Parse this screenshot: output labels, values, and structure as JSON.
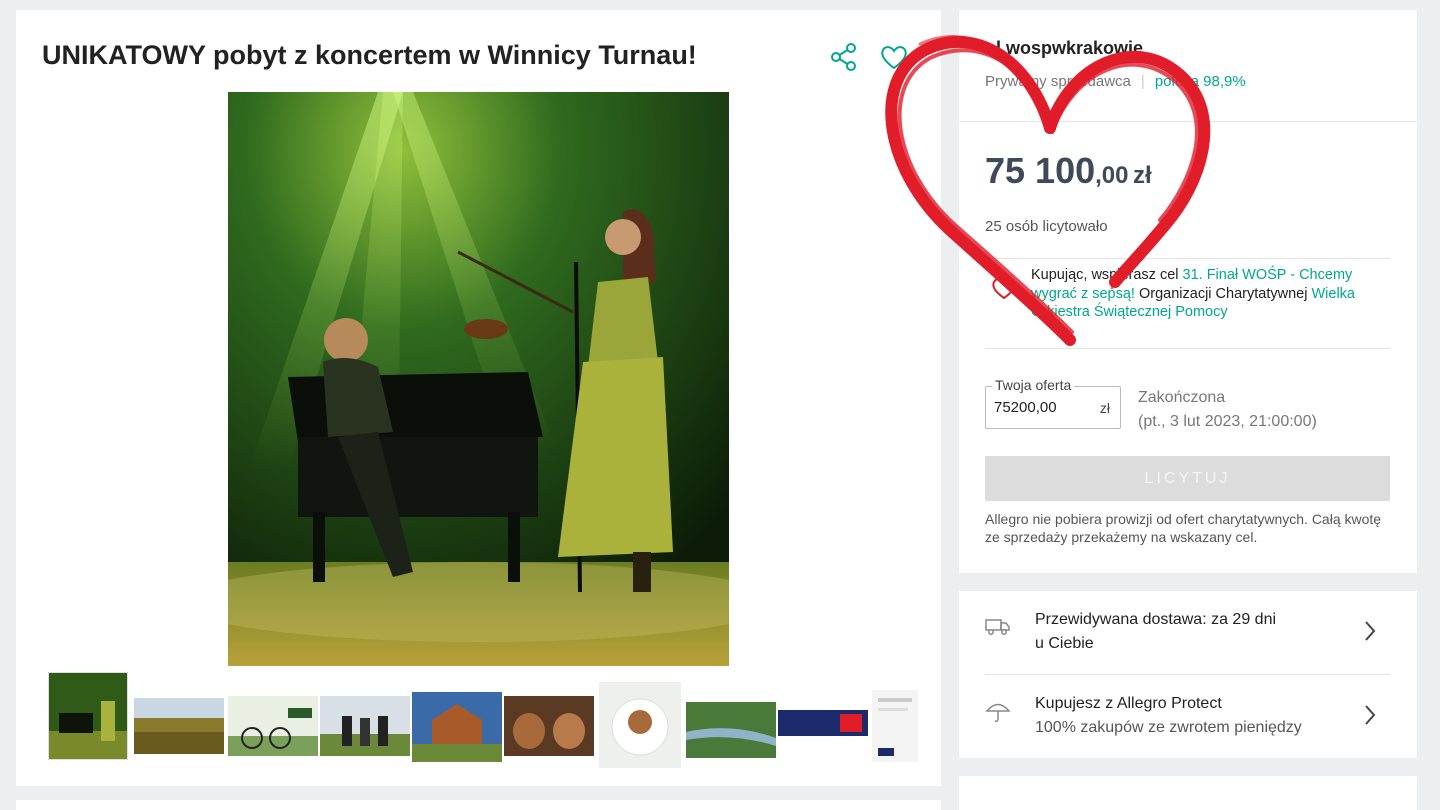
{
  "listing": {
    "title": "UNIKATOWY pobyt z koncertem w Winnicy Turnau!"
  },
  "icons": {
    "share": "share-icon",
    "favorite": "heart-outline-icon"
  },
  "seller": {
    "name": "ol wospwkrakowie",
    "type": "Prywatny sprzedawca",
    "rating": "poleca 98,9%"
  },
  "price": {
    "whole": "75 100",
    "fraction": ",00",
    "currency": "zł"
  },
  "bidders": "25 osób licytowało",
  "charity": {
    "prefix": "Kupując, wspierasz cel ",
    "goal": "31. Finał WOŚP - Chcemy wygrać z sepsą!",
    "org_prefix": " Organizacji Charytatywnej ",
    "org": "Wielka Orkiestra Świątecznej Pomocy"
  },
  "offer": {
    "legend": "Twoja oferta",
    "value": "75200,00",
    "unit": "zł"
  },
  "status": {
    "ended": "Zakończona",
    "date": "(pt., 3 lut 2023, 21:00:00)"
  },
  "bid_button": "LICYTUJ",
  "note": "Allegro nie pobiera prowizji od ofert charytatywnych. Całą kwotę ze sprzedaży przekażemy na wskazany cel.",
  "delivery": {
    "line1": "Przewidywana dostawa: za 29 dni",
    "line2": "u Ciebie"
  },
  "protect": {
    "line1": "Kupujesz z Allegro Protect",
    "line2": "100% zakupów ze zwrotem pieniędzy"
  },
  "colors": {
    "accent": "#00a790",
    "price": "#3e4a5a",
    "heart_overlay": "#e11d2a",
    "disabled_button": "#dcdcdc"
  }
}
